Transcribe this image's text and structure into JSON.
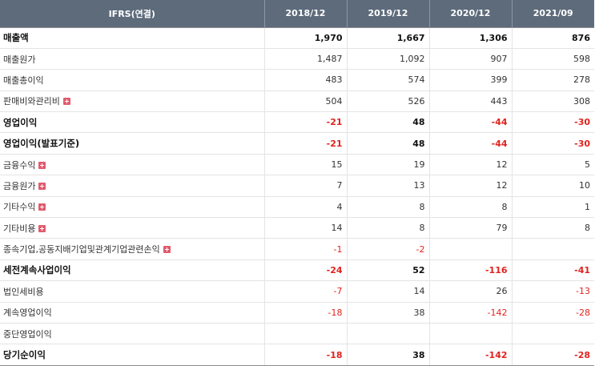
{
  "table": {
    "header": [
      "IFRS(연결)",
      "2018/12",
      "2019/12",
      "2020/12",
      "2021/09"
    ],
    "rows": [
      {
        "label": "매출액",
        "major": true,
        "expand": false,
        "values": [
          "1,970",
          "1,667",
          "1,306",
          "876"
        ]
      },
      {
        "label": "매출원가",
        "major": false,
        "expand": false,
        "values": [
          "1,487",
          "1,092",
          "907",
          "598"
        ]
      },
      {
        "label": "매출총이익",
        "major": false,
        "expand": false,
        "values": [
          "483",
          "574",
          "399",
          "278"
        ]
      },
      {
        "label": "판매비와관리비",
        "major": false,
        "expand": true,
        "values": [
          "504",
          "526",
          "443",
          "308"
        ]
      },
      {
        "label": "영업이익",
        "major": true,
        "expand": false,
        "values": [
          "-21",
          "48",
          "-44",
          "-30"
        ]
      },
      {
        "label": "영업이익(발표기준)",
        "major": true,
        "expand": false,
        "values": [
          "-21",
          "48",
          "-44",
          "-30"
        ]
      },
      {
        "label": "금융수익",
        "major": false,
        "expand": true,
        "values": [
          "15",
          "19",
          "12",
          "5"
        ]
      },
      {
        "label": "금융원가",
        "major": false,
        "expand": true,
        "values": [
          "7",
          "13",
          "12",
          "10"
        ]
      },
      {
        "label": "기타수익",
        "major": false,
        "expand": true,
        "values": [
          "4",
          "8",
          "8",
          "1"
        ]
      },
      {
        "label": "기타비용",
        "major": false,
        "expand": true,
        "values": [
          "14",
          "8",
          "79",
          "8"
        ]
      },
      {
        "label": "종속기업,공동지배기업및관계기업관련손익",
        "major": false,
        "expand": true,
        "values": [
          "-1",
          "-2",
          "",
          ""
        ]
      },
      {
        "label": "세전계속사업이익",
        "major": true,
        "expand": false,
        "values": [
          "-24",
          "52",
          "-116",
          "-41"
        ]
      },
      {
        "label": "법인세비용",
        "major": false,
        "expand": false,
        "values": [
          "-7",
          "14",
          "26",
          "-13"
        ]
      },
      {
        "label": "계속영업이익",
        "major": false,
        "expand": false,
        "values": [
          "-18",
          "38",
          "-142",
          "-28"
        ]
      },
      {
        "label": "중단영업이익",
        "major": false,
        "expand": false,
        "values": [
          "",
          "",
          "",
          ""
        ]
      },
      {
        "label": "당기순이익",
        "major": true,
        "expand": false,
        "values": [
          "-18",
          "38",
          "-142",
          "-28"
        ]
      }
    ]
  },
  "colors": {
    "header_bg": "#5d6b7b",
    "negative": "#e0231e",
    "expand_icon": "#e15b6e"
  }
}
